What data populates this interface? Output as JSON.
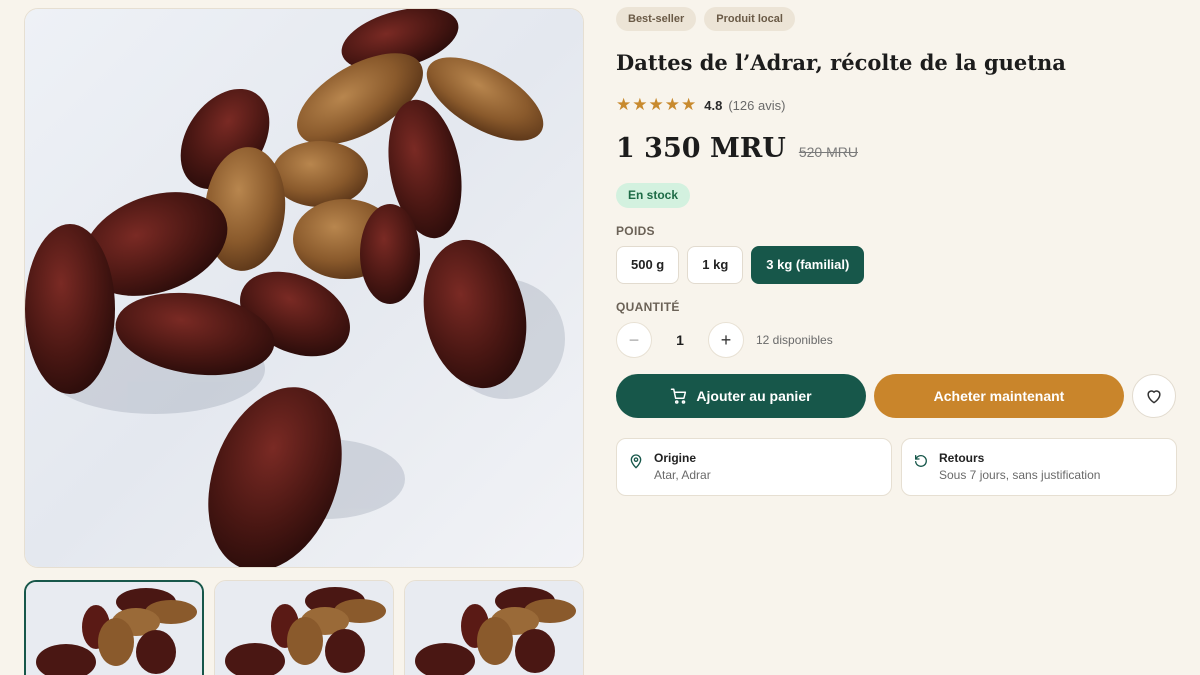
{
  "gallery": {
    "main_image_alt": "Dattes",
    "thumbnails": [
      "thumb-1",
      "thumb-2",
      "thumb-3"
    ],
    "active_index": 0
  },
  "badges": [
    "Best-seller",
    "Produit local"
  ],
  "product": {
    "title": "Dattes de l’Adrar, récolte de la guetna",
    "rating": "4.8",
    "rating_count": "(126 avis)",
    "stars": 5,
    "price": "1 350 MRU",
    "old_price": "520 MRU",
    "stock": "En stock"
  },
  "weight": {
    "label": "POIDS",
    "options": [
      "500 g",
      "1 kg",
      "3 kg (familial)"
    ],
    "selected": "3 kg (familial)"
  },
  "quantity": {
    "label": "QUANTITÉ",
    "minus": "−",
    "value": "1",
    "plus": "+",
    "available": "12 disponibles"
  },
  "actions": {
    "add_to_cart": "Ajouter au panier",
    "buy_now": "Acheter maintenant"
  },
  "info": {
    "origin_title": "Origine",
    "origin_value": "Atar, Adrar",
    "returns_title": "Retours",
    "returns_value": "Sous 7 jours, sans justification"
  },
  "colors": {
    "primary": "#17574a",
    "accent": "#c9852b",
    "background": "#f8f4ec",
    "star": "#c88a2e"
  }
}
